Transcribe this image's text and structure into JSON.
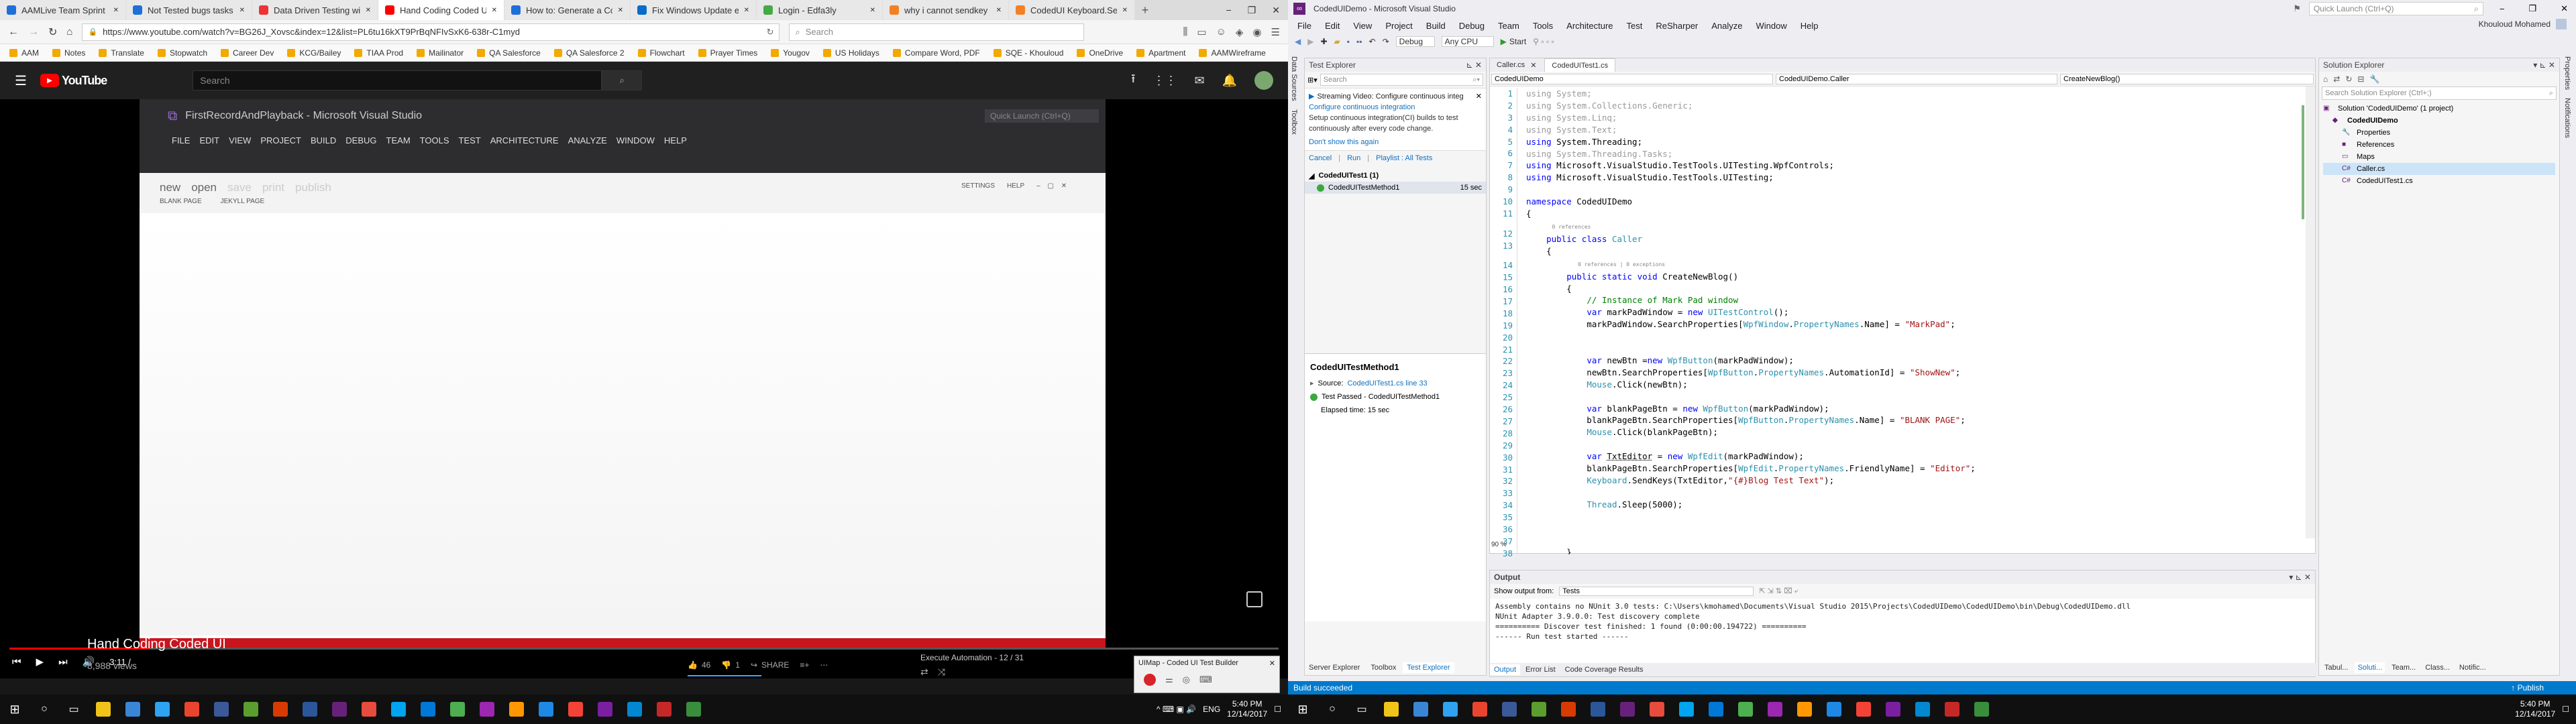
{
  "browser": {
    "tabs": [
      "AAMLive Team Sprint b",
      "Not Tested bugs tasks",
      "Data Driven Testing wit",
      "Hand Coding Coded U",
      "How to: Generate a Co",
      "Fix Windows Update er",
      "Login - Edfa3ly",
      "why i cannot sendkey",
      "CodedUI Keyboard.Sen"
    ],
    "url": "https://www.youtube.com/watch?v=BG26J_Xovsc&index=12&list=PL6tu16kXT9PrBqNFIvSxK6-638r-C1myd",
    "search_placeholder": "Search",
    "bookmarks": [
      "AAM",
      "Notes",
      "Translate",
      "Stopwatch",
      "Career Dev",
      "KCG/Bailey",
      "TIAA Prod",
      "Mailinator",
      "QA Salesforce",
      "QA Salesforce 2",
      "Flowchart",
      "Prayer Times",
      "Yougov",
      "US Holidays",
      "Compare Word, PDF",
      "SQE - Khouloud",
      "OneDrive",
      "Apartment",
      "AAMWireframe"
    ],
    "window_controls": [
      "−",
      "❐",
      "✕"
    ]
  },
  "youtube": {
    "logo_text": "YouTube",
    "search_placeholder": "Search",
    "video_title": "Hand Coding Coded UI",
    "views": "8,988 views",
    "time": "3:11 /",
    "likes": "46",
    "dislikes": "1",
    "share": "SHARE",
    "up_next": "Execute Automation - 12 / 31",
    "inner_vs": {
      "title": "FirstRecordAndPlayback - Microsoft Visual Studio",
      "quick_launch": "Quick Launch (Ctrl+Q)",
      "menu": [
        "FILE",
        "EDIT",
        "VIEW",
        "PROJECT",
        "BUILD",
        "DEBUG",
        "TEAM",
        "TOOLS",
        "TEST",
        "ARCHITECTURE",
        "ANALYZE",
        "WINDOW",
        "HELP"
      ]
    },
    "markpad": {
      "menu": [
        "new",
        "open",
        "save",
        "print",
        "publish"
      ],
      "sub": [
        "BLANK PAGE",
        "JEKYLL PAGE"
      ],
      "right": [
        "SETTINGS",
        "HELP"
      ]
    }
  },
  "uimap": {
    "title": "UIMap - Coded UI Test Builder"
  },
  "vs": {
    "title": "CodedUIDemo - Microsoft Visual Studio",
    "quick_launch": "Quick Launch (Ctrl+Q)",
    "user": "Khouloud Mohamed",
    "menu": [
      "File",
      "Edit",
      "View",
      "Project",
      "Build",
      "Debug",
      "Team",
      "Tools",
      "Architecture",
      "Test",
      "ReSharper",
      "Analyze",
      "Window",
      "Help"
    ],
    "toolbar": {
      "config": "Debug",
      "platform": "Any CPU",
      "start": "Start"
    },
    "left_strip": [
      "Data Sources",
      "Toolbox"
    ],
    "test_explorer": {
      "title": "Test Explorer",
      "search": "Search",
      "notice_title": "Streaming Video: Configure continuous integ",
      "notice_link": "Configure continuous integration",
      "notice_text1": "Setup continuous integration(CI) builds to test",
      "notice_text2": "continuously after every code change.",
      "notice_hide": "Don't show this again",
      "actions": [
        "Cancel",
        "Run",
        "Playlist : All Tests"
      ],
      "group": "CodedUITest1 (1)",
      "test": "CodedUITestMethod1",
      "duration": "15 sec",
      "detail_title": "CodedUITestMethod1",
      "source_label": "Source:",
      "source_link": "CodedUITest1.cs line 33",
      "result": "Test Passed - CodedUITestMethod1",
      "elapsed": "Elapsed time: 15 sec",
      "bottom_tabs": [
        "Server Explorer",
        "Toolbox",
        "Test Explorer"
      ]
    },
    "editor": {
      "tabs": [
        "Caller.cs",
        "CodedUITest1.cs"
      ],
      "nav": [
        "CodedUIDemo",
        "CodedUIDemo.Caller",
        "CreateNewBlog()"
      ],
      "zoom": "90 %",
      "line_numbers": [
        "1",
        "2",
        "3",
        "4",
        "5",
        "6",
        "7",
        "8",
        "9",
        "10",
        "11",
        "",
        "12",
        "13",
        "",
        "14",
        "15",
        "16",
        "17",
        "18",
        "19",
        "20",
        "21",
        "22",
        "23",
        "24",
        "25",
        "26",
        "27",
        "28",
        "29",
        "30",
        "31",
        "32",
        "33",
        "34",
        "35",
        "36",
        "37",
        "38"
      ],
      "refs": [
        "0 references",
        "0 references | 0 exceptions"
      ]
    },
    "output": {
      "title": "Output",
      "show_from_label": "Show output from:",
      "show_from": "Tests",
      "lines": [
        "Assembly contains no NUnit 3.0 tests: C:\\Users\\kmohamed\\Documents\\Visual Studio 2015\\Projects\\CodedUIDemo\\CodedUIDemo\\bin\\Debug\\CodedUIDemo.dll",
        "NUnit Adapter 3.9.0.0: Test discovery complete",
        "========== Discover test finished: 1 found (0:00:00.194722) ==========",
        "------ Run test started ------"
      ],
      "tabs": [
        "Output",
        "Error List",
        "Code Coverage Results"
      ]
    },
    "solution_explorer": {
      "title": "Solution Explorer",
      "search": "Search Solution Explorer (Ctrl+;)",
      "items": [
        "Solution 'CodedUIDemo' (1 project)",
        "CodedUIDemo",
        "Properties",
        "References",
        "Maps",
        "Caller.cs",
        "CodedUITest1.cs"
      ],
      "bottom_tabs": [
        "Tabul...",
        "Soluti...",
        "Team...",
        "Class...",
        "Notific..."
      ]
    },
    "right_strip": [
      "Properties",
      "Notifications"
    ],
    "status": {
      "text": "Build succeeded",
      "publish": "↑ Publish"
    }
  },
  "taskbar": {
    "time_left": "5:40 PM",
    "date_left": "12/14/2017",
    "time_right": "5:40 PM",
    "date_right": "12/14/2017",
    "lang": "ENG"
  },
  "colors": {
    "yt_red": "#ff0000",
    "vs_purple": "#68217a",
    "vs_blue": "#007acc",
    "pass_green": "#3ca83c"
  }
}
